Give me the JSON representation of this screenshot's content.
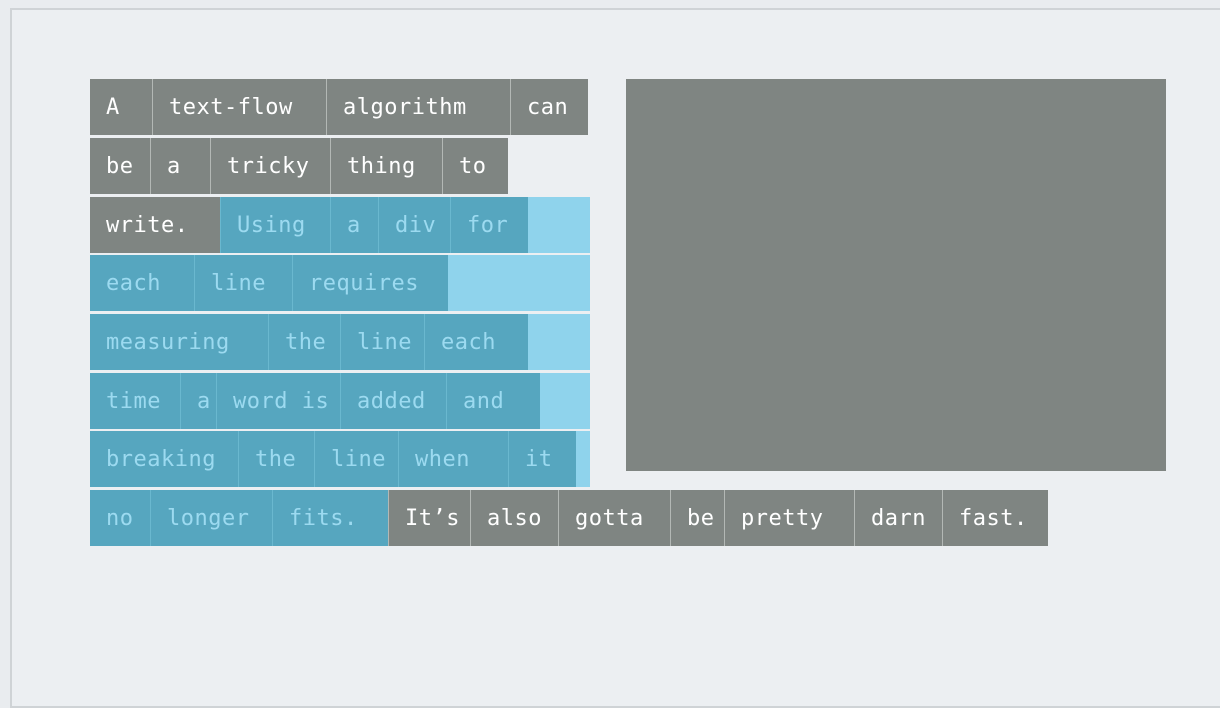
{
  "lines": [
    [
      "A",
      "text-flow",
      "algorithm",
      "can"
    ],
    [
      "be",
      "a",
      "tricky",
      "thing",
      "to"
    ],
    [
      "write.",
      "Using",
      "a",
      "div",
      "for"
    ],
    [
      "each",
      "line",
      "requires"
    ],
    [
      "measuring",
      "the",
      "line",
      "each"
    ],
    [
      "time",
      "a",
      "word is",
      "added",
      "and"
    ],
    [
      "breaking",
      "the",
      "line",
      "when",
      "it"
    ],
    [
      "no",
      "longer",
      "fits.",
      "It’s",
      "also",
      "gotta",
      "be",
      "pretty",
      "darn",
      "fast."
    ]
  ],
  "colors": {
    "gray": "#7f8582",
    "blue": "#8fd3ec",
    "blue_dark": "#56a6bf",
    "blue_text": "#9cdaf0",
    "background": "#eceff2"
  }
}
